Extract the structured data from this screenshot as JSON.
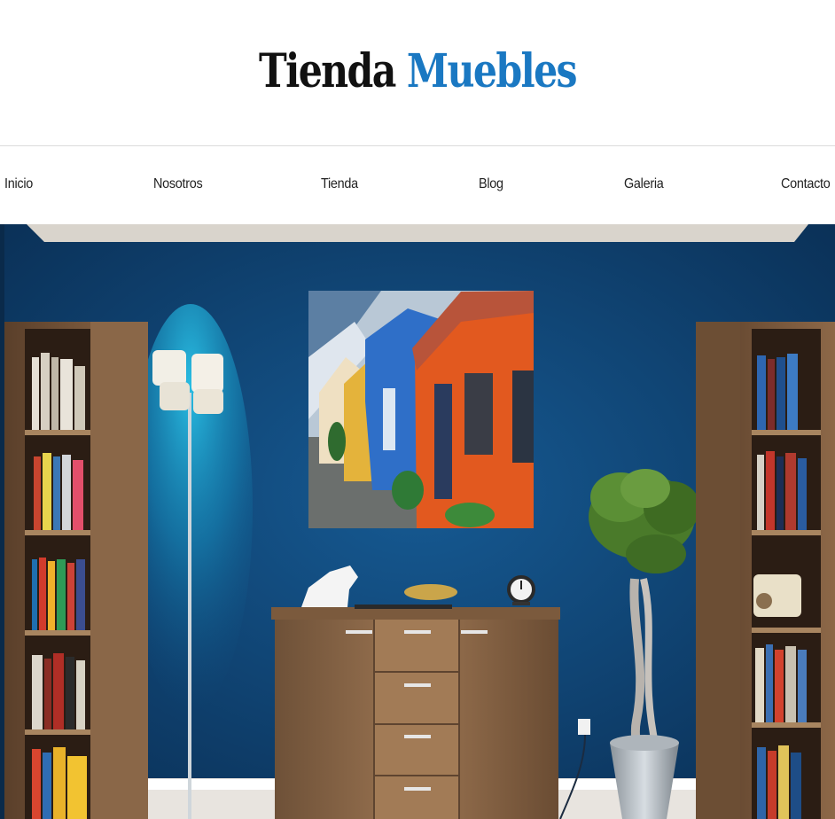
{
  "site": {
    "title_part1": "Tienda",
    "title_part2": "Muebles",
    "accent_color": "#1a78c2"
  },
  "nav": {
    "items": [
      {
        "label": "Inicio"
      },
      {
        "label": "Nosotros"
      },
      {
        "label": "Tienda"
      },
      {
        "label": "Blog"
      },
      {
        "label": "Galeria"
      },
      {
        "label": "Contacto"
      }
    ]
  },
  "hero": {
    "image": "living-room-blue-wall",
    "wall_color": "#0f3f6e",
    "painting_subject": "colorful-houses"
  }
}
